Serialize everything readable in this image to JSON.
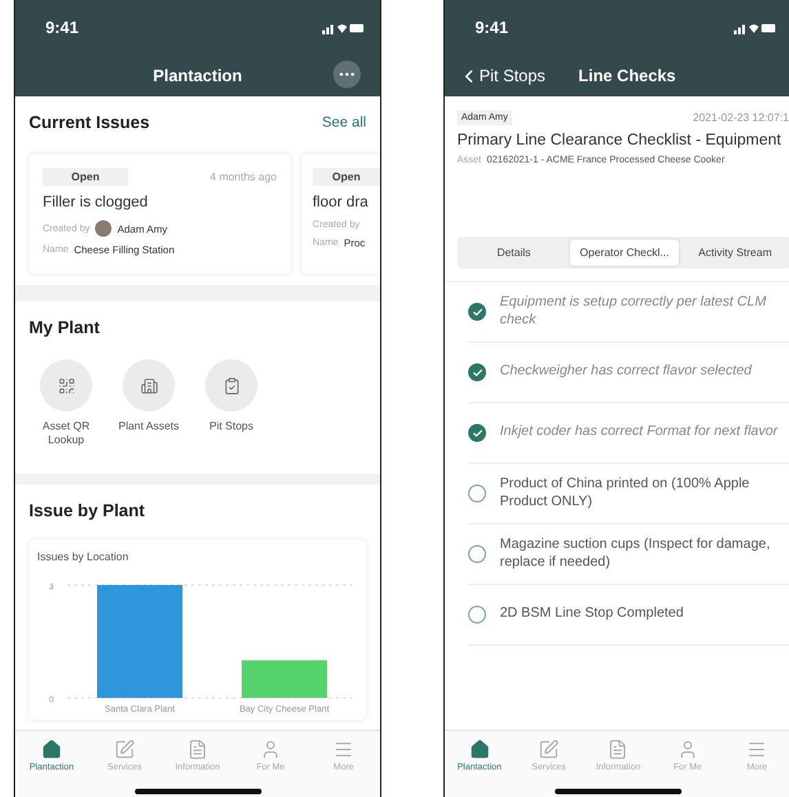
{
  "home_screen": {
    "status_bar": {
      "time": "9:41"
    },
    "title": "Plantaction",
    "current_issues": {
      "title": "Current Issues",
      "link": "See all",
      "cards": [
        {
          "status": "Open",
          "age": "4 months ago",
          "title": "Filler is clogged",
          "created_by_label": "Created by",
          "creator": "Adam Amy",
          "name_label": "Name",
          "name": "Cheese Filling Station"
        },
        {
          "status": "Open",
          "title": "floor dra",
          "created_by_label": "Created by",
          "name_label": "Name",
          "name": "Proc"
        }
      ]
    },
    "my_plant": {
      "title": "My Plant",
      "shortcuts": [
        {
          "label": "Asset QR Lookup",
          "kind": "qr"
        },
        {
          "label": "Plant Assets",
          "kind": "building"
        },
        {
          "label": "Pit Stops",
          "kind": "clipboard"
        }
      ]
    },
    "issue_by_plant": {
      "title": "Issue by Plant",
      "chart_data": {
        "type": "bar",
        "title": "Issues by Location",
        "categories": [
          "Santa Clara Plant",
          "Bay City Cheese Plant"
        ],
        "stacked": true,
        "ylim": [
          0,
          3
        ],
        "yticks": [
          0,
          3
        ],
        "series": [
          {
            "color": "#2e96da",
            "values": [
              3,
              null
            ]
          },
          {
            "color": "#55d46e",
            "values": [
              null,
              1
            ]
          }
        ]
      }
    },
    "tab_bar": [
      {
        "label": "Plantaction",
        "kind": "home",
        "selected": true
      },
      {
        "label": "Services",
        "kind": "edit",
        "selected": false
      },
      {
        "label": "Information",
        "kind": "document",
        "selected": false
      },
      {
        "label": "For Me",
        "kind": "person",
        "selected": false
      },
      {
        "label": "More",
        "kind": "menu",
        "selected": false
      }
    ]
  },
  "checklist_screen": {
    "status_bar": {
      "time": "9:41"
    },
    "back": "Pit Stops",
    "title": "Line Checks",
    "author": "Adam Amy",
    "timestamp": "2021-02-23 12:07:1",
    "heading": "Primary Line Clearance Checklist - Equipment",
    "asset_label": "Asset",
    "asset": "02162021-1 - ACME France Processed Cheese Cooker",
    "segments": [
      {
        "label": "Details",
        "selected": false
      },
      {
        "label": "Operator Checkl...",
        "selected": true
      },
      {
        "label": "Activity Stream",
        "selected": false
      }
    ],
    "items": [
      {
        "text": "Equipment is setup correctly per latest CLM check",
        "checked": true
      },
      {
        "text": "Checkweigher has correct flavor selected",
        "checked": true
      },
      {
        "text": "Inkjet coder has correct Format for next flavor",
        "checked": true
      },
      {
        "text": "Product of China printed on (100% Apple Product ONLY)",
        "checked": false
      },
      {
        "text": "Magazine suction cups (Inspect for damage, replace if needed)",
        "checked": false
      },
      {
        "text": "2D BSM Line Stop Completed",
        "checked": false
      }
    ],
    "tab_bar": [
      {
        "label": "Plantaction",
        "kind": "home",
        "selected": true
      },
      {
        "label": "Services",
        "kind": "edit",
        "selected": false
      },
      {
        "label": "Information",
        "kind": "document",
        "selected": false
      },
      {
        "label": "For Me",
        "kind": "person",
        "selected": false
      },
      {
        "label": "More",
        "kind": "menu",
        "selected": false
      }
    ]
  }
}
